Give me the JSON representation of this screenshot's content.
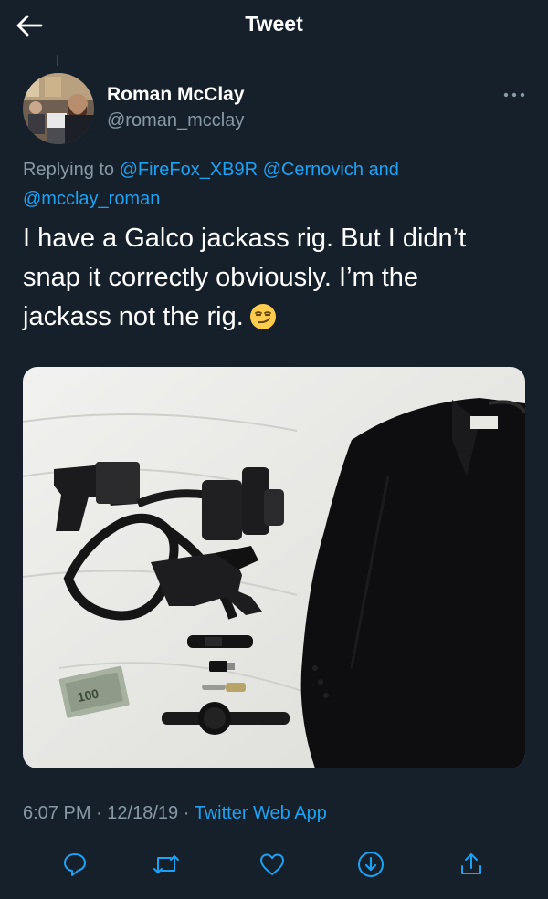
{
  "header": {
    "title": "Tweet",
    "back_icon": "arrow-left-icon"
  },
  "author": {
    "name": "Roman McClay",
    "handle": "@roman_mcclay"
  },
  "reply": {
    "prefix": "Replying to",
    "mention1": "@FireFox_XB9R",
    "mention2": "@Cernovich",
    "conjunction": "and",
    "mention3": "@mcclay_roman"
  },
  "tweet": {
    "line1": "I have a Galco jackass rig. But I didn’t",
    "line2": "snap it correctly obviously. I’m the",
    "line3": "jackass not the rig.",
    "emoji": "smirking-face-emoji"
  },
  "media_label": "100",
  "meta": {
    "time": "6:07 PM",
    "date": "12/18/19",
    "separator": "·",
    "app": "Twitter Web App"
  },
  "actions": [
    "reply-icon",
    "retweet-icon",
    "like-icon",
    "download-icon",
    "share-icon"
  ],
  "colors": {
    "background": "#15202b",
    "accent": "#1da1f2",
    "secondary_text": "#8899a6"
  }
}
